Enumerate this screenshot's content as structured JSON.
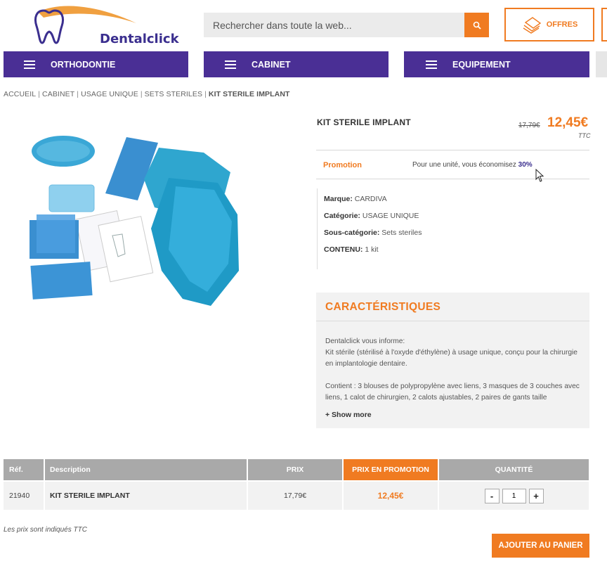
{
  "header": {
    "logo_text": "Dentalclick",
    "search_placeholder": "Rechercher dans toute la web...",
    "offers_label": "OFFRES"
  },
  "nav": {
    "items": [
      {
        "label": "ORTHODONTIE"
      },
      {
        "label": "CABINET"
      },
      {
        "label": "EQUIPEMENT"
      }
    ]
  },
  "breadcrumb": {
    "items": [
      "ACCUEIL",
      "CABINET",
      "USAGE UNIQUE",
      "SETS STERILES"
    ],
    "current": "KIT STERILE IMPLANT"
  },
  "product": {
    "title": "KIT STERILE IMPLANT",
    "old_price": "17,79€",
    "new_price": "12,45€",
    "tax_label": "TTC",
    "promo_label": "Promotion",
    "promo_text": "Pour une unité, vous économisez ",
    "promo_percent": "30%",
    "specs": [
      {
        "label": "Marque:",
        "value": " CARDIVA"
      },
      {
        "label": "Catégorie:",
        "value": " USAGE UNIQUE"
      },
      {
        "label": "Sous-catégorie:",
        "value": " Sets steriles"
      },
      {
        "label": "CONTENU:",
        "value": " 1 kit"
      }
    ]
  },
  "characteristics": {
    "title": "CARACTÉRISTIQUES",
    "paragraph1_line1": "Dentalclick vous informe:",
    "paragraph1_line2": "Kit stérile (stérilisé à l'oxyde d'éthylène) à usage unique, conçu pour la chirurgie en implantologie dentaire.",
    "paragraph2": "Contient : 3 blouses de polypropylène avec liens, 3 masques de 3 couches avec liens, 1 calot de chirurgien, 2 calots ajustables, 2 paires de gants taille",
    "show_more": "+ Show more"
  },
  "table": {
    "headers": {
      "ref": "Réf.",
      "description": "Description",
      "price": "PRIX",
      "promo_price": "PRIX EN PROMOTION",
      "quantity": "QUANTITÉ"
    },
    "row": {
      "ref": "21940",
      "description": "KIT STERILE IMPLANT",
      "price": "17,79€",
      "promo_price": "12,45€",
      "quantity": "1"
    },
    "minus": "-",
    "plus": "+"
  },
  "footer": {
    "note": "Les prix sont indiqués TTC",
    "add_to_cart": "AJOUTER AU PANIER"
  },
  "colors": {
    "accent": "#f07b21",
    "nav": "#4a2f95"
  }
}
